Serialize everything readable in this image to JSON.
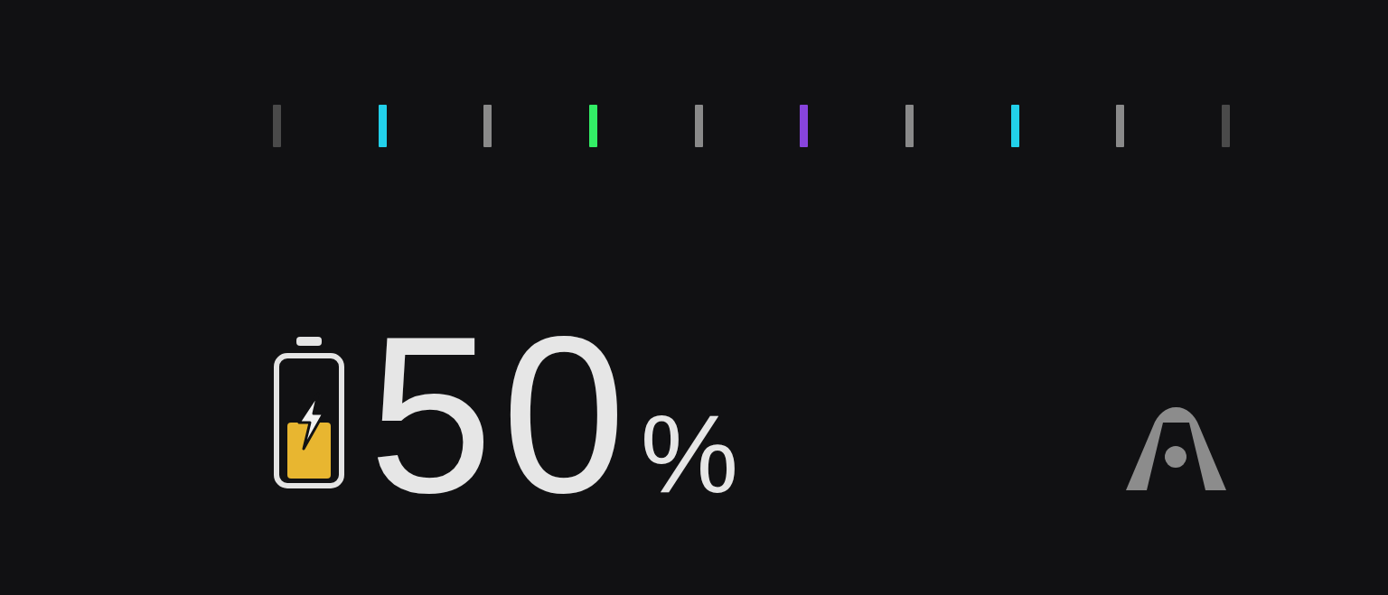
{
  "ticks": [
    {
      "color": "#4a4a4a"
    },
    {
      "color": "#22d0ea"
    },
    {
      "color": "#8a8a8a"
    },
    {
      "color": "#33ee66"
    },
    {
      "color": "#8a8a8a"
    },
    {
      "color": "#8844dd"
    },
    {
      "color": "#8a8a8a"
    },
    {
      "color": "#22d0ea"
    },
    {
      "color": "#8a8a8a"
    },
    {
      "color": "#4a4a4a"
    }
  ],
  "battery": {
    "charging": true,
    "value": "50",
    "unit": "%"
  }
}
